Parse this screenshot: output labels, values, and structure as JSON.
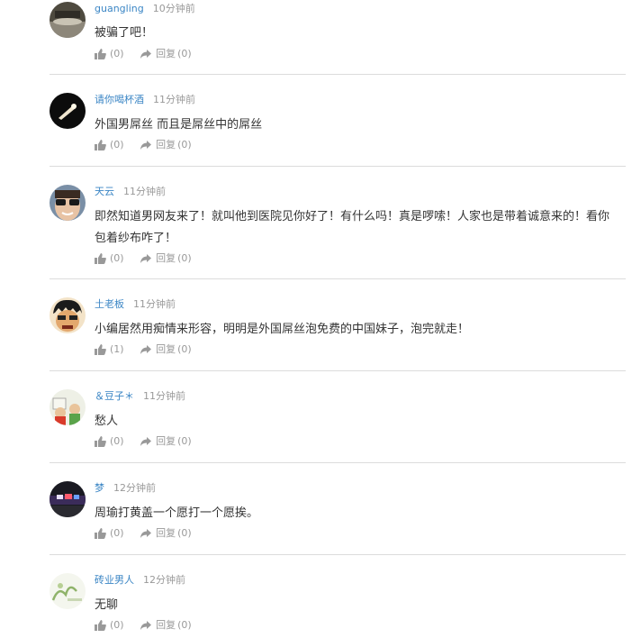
{
  "comments": [
    {
      "user": "guangling",
      "time": "10分钟前",
      "text": "被骗了吧！",
      "likes": "(0)",
      "reply_label": "回复",
      "reply_count": "(0)",
      "avatar_icon": "avatar-dark-photo"
    },
    {
      "user": "请你喝杯酒",
      "time": "11分钟前",
      "text": "外国男屌丝  而且是屌丝中的屌丝",
      "likes": "(0)",
      "reply_label": "回复",
      "reply_count": "(0)",
      "avatar_icon": "avatar-black-with-light"
    },
    {
      "user": "天云",
      "time": "11分钟前",
      "text": "即然知道男网友来了！就叫他到医院见你好了！有什么吗！真是啰嗦！人家也是带着诚意来的！看你包着纱布咋了！",
      "likes": "(0)",
      "reply_label": "回复",
      "reply_count": "(0)",
      "avatar_icon": "avatar-glasses-face"
    },
    {
      "user": "土老板",
      "time": "11分钟前",
      "text": "小编居然用痴情来形容，明明是外国屌丝泡免费的中国妹子，泡完就走！",
      "likes": "(1)",
      "reply_label": "回复",
      "reply_count": "(0)",
      "avatar_icon": "avatar-cartoon-face"
    },
    {
      "user": "＆豆子＊",
      "time": "11分钟前",
      "text": "愁人",
      "likes": "(0)",
      "reply_label": "回复",
      "reply_count": "(0)",
      "avatar_icon": "avatar-cartoon-figures"
    },
    {
      "user": "梦",
      "time": "12分钟前",
      "text": "周瑜打黄盖一个愿打一个愿挨。",
      "likes": "(0)",
      "reply_label": "回复",
      "reply_count": "(0)",
      "avatar_icon": "avatar-night-lights"
    },
    {
      "user": "砖业男人",
      "time": "12分钟前",
      "text": "无聊",
      "likes": "(0)",
      "reply_label": "回复",
      "reply_count": "(0)",
      "avatar_icon": "avatar-green-drawing"
    }
  ]
}
